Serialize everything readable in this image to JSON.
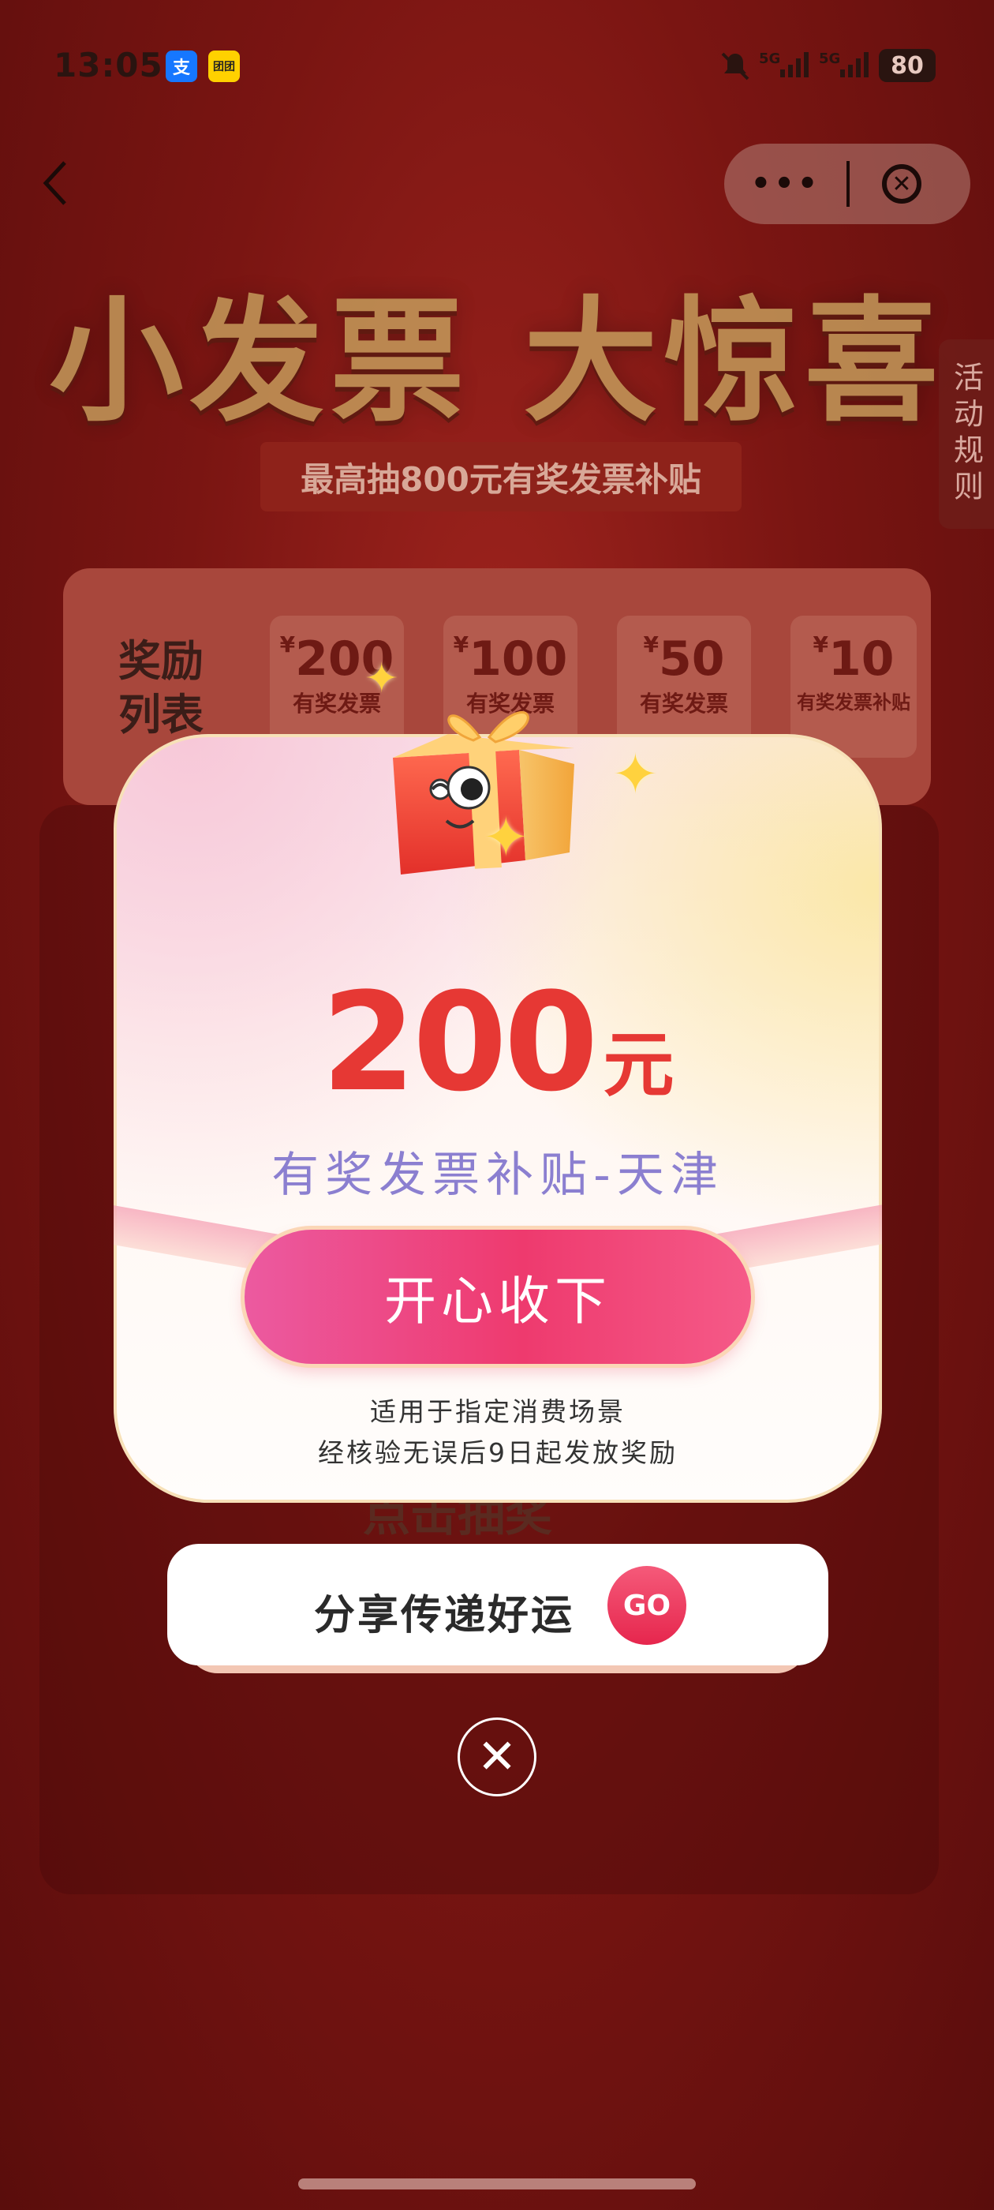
{
  "status_bar": {
    "time": "13:05",
    "alipay_icon": "支",
    "meituan_icon": "团团",
    "signal_1": "5G",
    "signal_2": "5G",
    "battery": "80"
  },
  "nav": {
    "back_icon": "‹",
    "more_icon": "•••",
    "close_icon": "✕"
  },
  "banner": {
    "title": "小发票 大惊喜",
    "subtitle": "最高抽800元有奖发票补贴",
    "rules_tab": "活动规则"
  },
  "prize_list": {
    "label": "奖励列表",
    "items": [
      {
        "currency": "¥",
        "amount": "200",
        "desc": "有奖发票"
      },
      {
        "currency": "¥",
        "amount": "100",
        "desc": "有奖发票"
      },
      {
        "currency": "¥",
        "amount": "50",
        "desc": "有奖发票"
      },
      {
        "currency": "¥",
        "amount": "10",
        "desc": "有奖发票补贴"
      }
    ]
  },
  "machine": {
    "draw_label": "点击抽奖"
  },
  "modal": {
    "amount": "200",
    "unit": "元",
    "prize_name": "有奖发票补贴-天津",
    "accept_button": "开心收下",
    "note_line1": "适用于指定消费场景",
    "note_line2": "经核验无误后9日起发放奖励"
  },
  "share": {
    "label": "分享传递好运",
    "go": "GO"
  },
  "close_button": "✕",
  "colors": {
    "accent_red": "#e63834",
    "prize_name_purple": "#8b7fd0",
    "button_pink": "#ee3a6e",
    "background_red": "#7a1512"
  },
  "icons": [
    "alipay-icon",
    "meituan-icon",
    "mute-icon",
    "back-icon",
    "more-icon",
    "close-icon",
    "gift-icon",
    "sparkle-icon",
    "go-icon",
    "close-circle-icon"
  ]
}
